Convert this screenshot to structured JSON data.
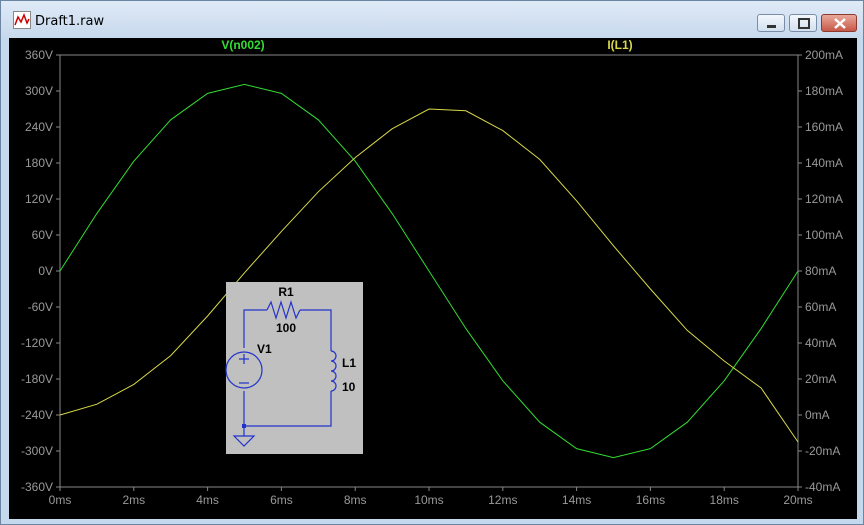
{
  "window": {
    "title": "Draft1.raw"
  },
  "schematic": {
    "r1_name": "R1",
    "r1_value": "100",
    "v1_name": "V1",
    "l1_name": "L1",
    "l1_value": "10"
  },
  "chart_data": {
    "type": "line",
    "xlabel": "",
    "ylabel": "",
    "ylabel_right": "",
    "x_ticks": [
      "0ms",
      "2ms",
      "4ms",
      "6ms",
      "8ms",
      "10ms",
      "12ms",
      "14ms",
      "16ms",
      "18ms",
      "20ms"
    ],
    "y_ticks_left": [
      "360V",
      "300V",
      "240V",
      "180V",
      "120V",
      "60V",
      "0V",
      "-60V",
      "-120V",
      "-180V",
      "-240V",
      "-300V",
      "-360V"
    ],
    "y_ticks_right": [
      "200mA",
      "180mA",
      "160mA",
      "140mA",
      "120mA",
      "100mA",
      "80mA",
      "60mA",
      "40mA",
      "20mA",
      "0mA",
      "-20mA",
      "-40mA"
    ],
    "xlim": [
      0,
      20
    ],
    "ylim_left": [
      -360,
      360
    ],
    "ylim_right": [
      -40,
      200
    ],
    "grid": false,
    "series": [
      {
        "name": "V(n002)",
        "axis": "left",
        "color": "#33dd33",
        "x": [
          0,
          1,
          2,
          3,
          4,
          5,
          6,
          7,
          8,
          9,
          10,
          11,
          12,
          13,
          14,
          15,
          16,
          17,
          18,
          19,
          20
        ],
        "values": [
          0,
          96,
          183,
          252,
          296,
          311,
          296,
          252,
          183,
          96,
          0,
          -96,
          -183,
          -252,
          -296,
          -311,
          -296,
          -252,
          -183,
          -96,
          0
        ]
      },
      {
        "name": "I(L1)",
        "axis": "right",
        "color": "#d8d84a",
        "x": [
          0,
          1,
          2,
          3,
          4,
          5,
          6,
          7,
          8,
          9,
          10,
          11,
          12,
          13,
          14,
          15,
          16,
          17,
          18,
          19,
          20
        ],
        "values": [
          0,
          6,
          17,
          33,
          55,
          79,
          102,
          124,
          143,
          159,
          170,
          169,
          158,
          142,
          119,
          94,
          70,
          47,
          30,
          15,
          -15
        ]
      }
    ]
  }
}
